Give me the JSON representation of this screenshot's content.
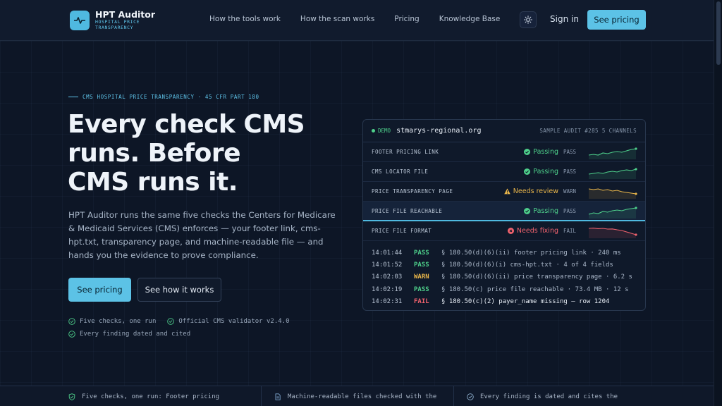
{
  "brand": {
    "title": "HPT Auditor",
    "subtitle": "HOSPITAL PRICE TRANSPARENCY",
    "accent": "#5cc2e6"
  },
  "nav": {
    "links": [
      "How the tools work",
      "How the scan works",
      "Pricing",
      "Knowledge Base"
    ],
    "theme_icon": "sun-icon",
    "signin": "Sign in",
    "cta": "See pricing"
  },
  "hero": {
    "eyebrow": "CMS HOSPITAL PRICE TRANSPARENCY · 45 CFR PART 180",
    "headline": [
      "Every check CMS",
      "runs. Before",
      "CMS runs it."
    ],
    "lede": "HPT Auditor runs the same five checks the Centers for Medicare & Medicaid Services (CMS) enforces — your footer link, cms-hpt.txt, transparency page, and machine-readable file — and hands you the evidence to prove compliance.",
    "primary_button": "See pricing",
    "secondary_button": "See how it works",
    "checks": [
      "Five checks, one run",
      "Official CMS validator v2.4.0",
      "Every finding dated and cited"
    ]
  },
  "audit_card": {
    "badge": "DEMO",
    "domain": "stmarys-regional.org",
    "sample": "SAMPLE AUDIT #285 5 CHANNELS",
    "rows": [
      {
        "label": "FOOTER PRICING LINK",
        "status": "Passing",
        "code": "PASS",
        "level": "pass",
        "trend": [
          0.3,
          0.35,
          0.3,
          0.45,
          0.4,
          0.5,
          0.55,
          0.5,
          0.6,
          0.7,
          0.75
        ]
      },
      {
        "label": "CMS LOCATOR FILE",
        "status": "Passing",
        "code": "PASS",
        "level": "pass",
        "trend": [
          0.35,
          0.4,
          0.45,
          0.4,
          0.5,
          0.55,
          0.5,
          0.6,
          0.65,
          0.6,
          0.7
        ]
      },
      {
        "label": "PRICE TRANSPARENCY PAGE",
        "status": "Needs review",
        "code": "WARN",
        "level": "warn",
        "trend": [
          0.7,
          0.65,
          0.7,
          0.6,
          0.65,
          0.55,
          0.6,
          0.5,
          0.45,
          0.4,
          0.35
        ]
      },
      {
        "label": "PRICE FILE REACHABLE",
        "status": "Passing",
        "code": "PASS",
        "level": "pass",
        "trend": [
          0.3,
          0.4,
          0.35,
          0.5,
          0.45,
          0.55,
          0.6,
          0.55,
          0.65,
          0.7,
          0.75
        ]
      },
      {
        "label": "PRICE FILE FORMAT",
        "status": "Needs fixing",
        "code": "FAIL",
        "level": "fail",
        "trend": [
          0.7,
          0.72,
          0.68,
          0.7,
          0.65,
          0.66,
          0.6,
          0.55,
          0.45,
          0.35,
          0.25
        ]
      }
    ],
    "log": [
      {
        "time": "14:01:44",
        "level": "PASS",
        "kind": "pass",
        "msg": "§ 180.50(d)(6)(ii) footer pricing link · 240 ms"
      },
      {
        "time": "14:01:52",
        "level": "PASS",
        "kind": "pass",
        "msg": "§ 180.50(d)(6)(i) cms-hpt.txt · 4 of 4 fields"
      },
      {
        "time": "14:02:03",
        "level": "WARN",
        "kind": "warn",
        "msg": "§ 180.50(d)(6)(ii) price transparency page · 6.2 s"
      },
      {
        "time": "14:02:19",
        "level": "PASS",
        "kind": "pass",
        "msg": "§ 180.50(c) price file reachable · 73.4 MB · 12 s"
      },
      {
        "time": "14:02:31",
        "level": "FAIL",
        "kind": "fail",
        "msg": "§ 180.50(c)(2) payer_name missing — row 1204"
      }
    ]
  },
  "strip": [
    {
      "icon": "shield-check-icon",
      "text": "Five checks, one run: Footer pricing"
    },
    {
      "icon": "file-icon",
      "text": "Machine-readable files checked with the"
    },
    {
      "icon": "check-circle-icon",
      "text": "Every finding is dated and cites the"
    }
  ],
  "colors": {
    "pass": "#4ed08b",
    "warn": "#e8b54a",
    "fail": "#f0626d"
  }
}
